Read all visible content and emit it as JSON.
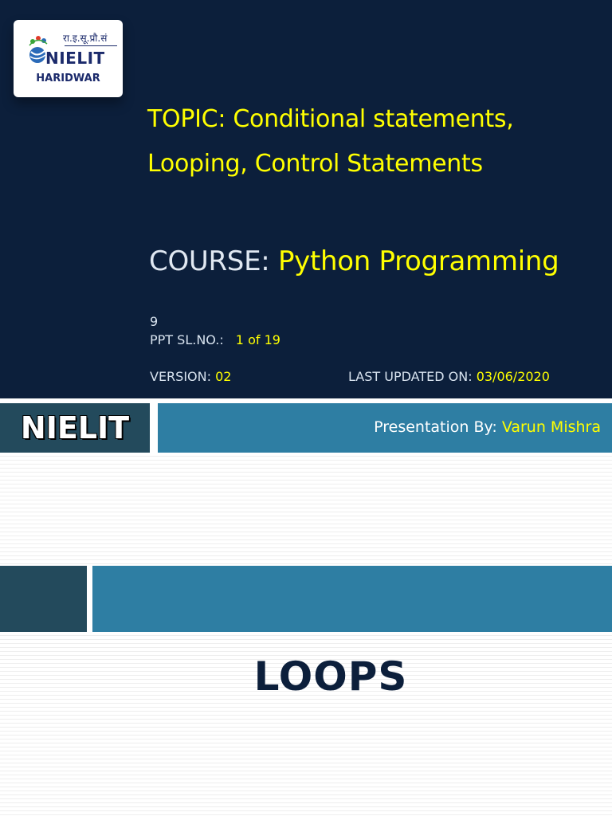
{
  "logo": {
    "hindi_text": "रा.इ.सू.प्रौ.सं",
    "name": "NIELIT",
    "city": "HARIDWAR",
    "icon": "nielit-globe-logo-icon"
  },
  "title_slide": {
    "topic_line1": "TOPIC: Conditional statements,",
    "topic_line2": "Looping, Control Statements",
    "course_label": "COURSE:",
    "course_value": "Python Programming",
    "number": "9",
    "ppt_label": "PPT SL.NO.:",
    "ppt_value": "1 of 19",
    "version_label": "VERSION:",
    "version_value": "02",
    "updated_label": "LAST UPDATED ON:",
    "updated_value": "03/06/2020"
  },
  "footer": {
    "brand": "NIELIT",
    "presentation_label": "Presentation By:",
    "presenter": "Varun Mishra"
  },
  "section_slide": {
    "heading": "LOOPS"
  },
  "colors": {
    "navy": "#0c1f3b",
    "accent_yellow": "#ffff00",
    "teal_dark": "#234a5c",
    "teal_bar": "#2e7ea3"
  }
}
